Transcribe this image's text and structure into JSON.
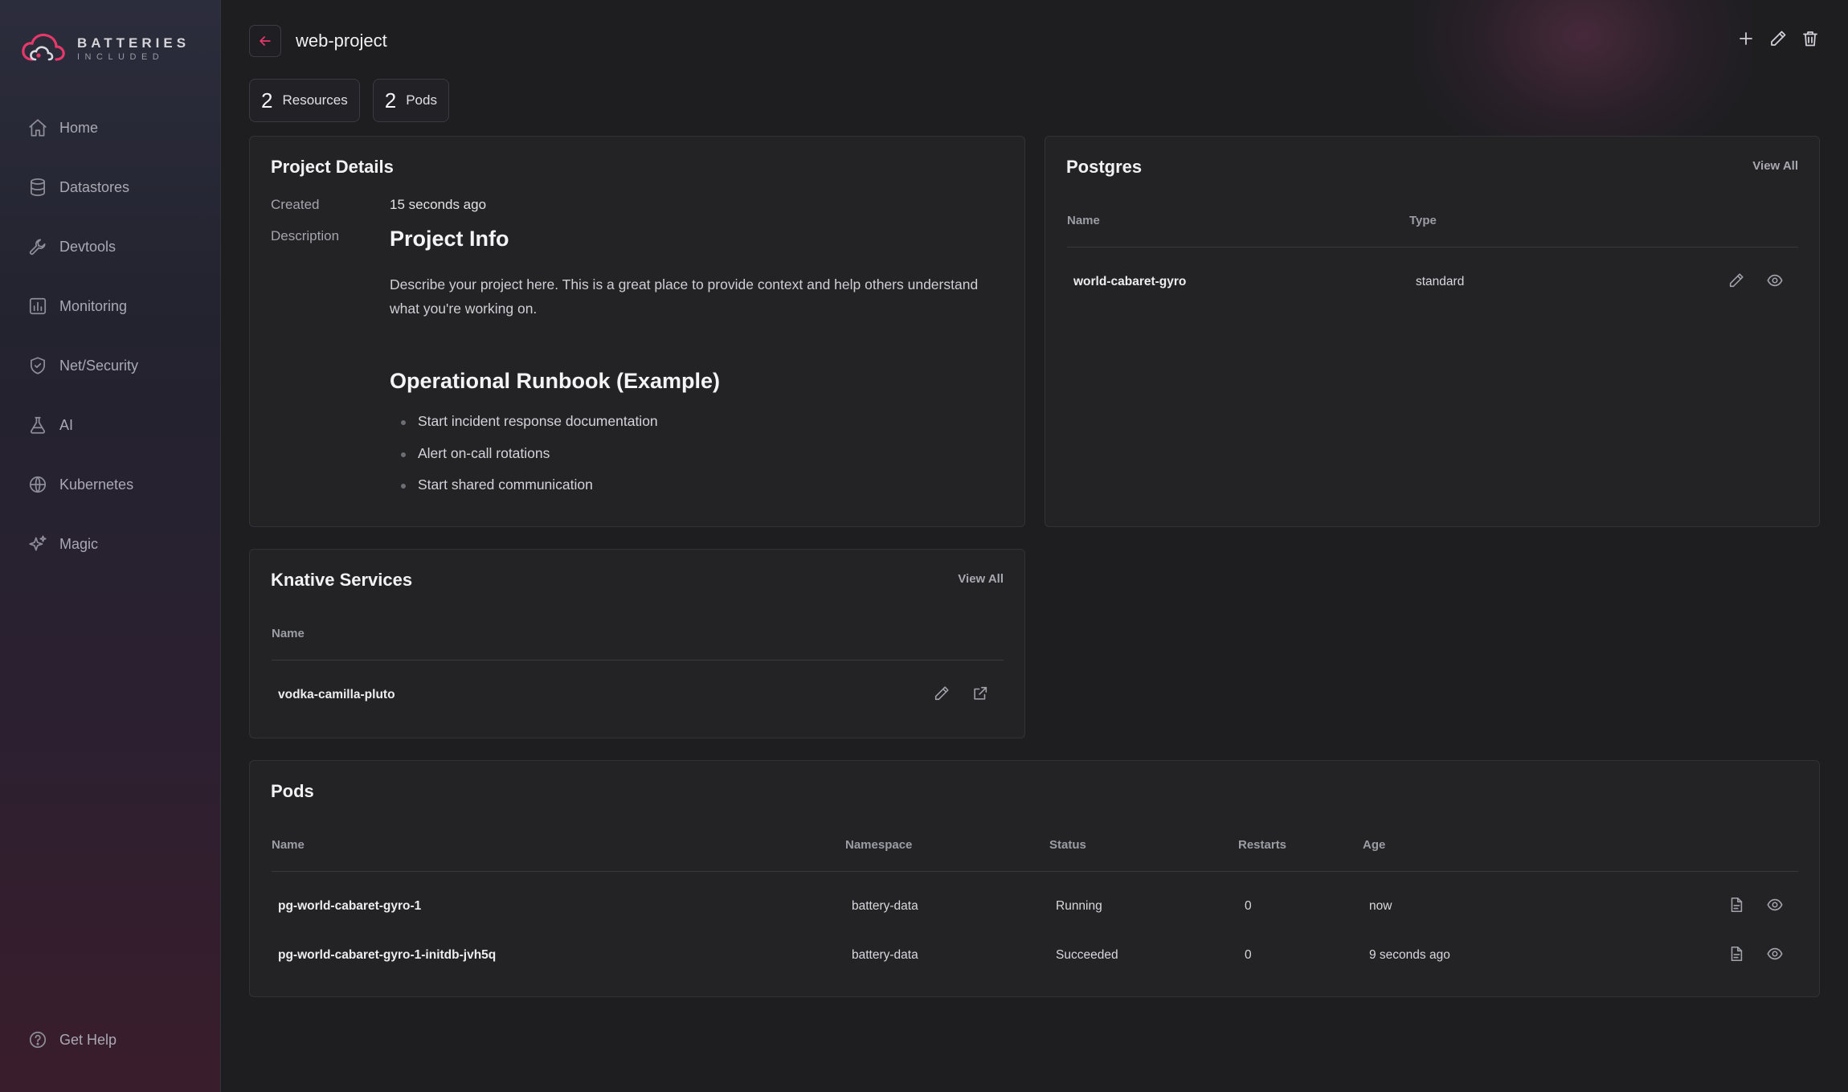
{
  "brand": {
    "title": "BATTERIES",
    "subtitle": "INCLUDED"
  },
  "sidebar": {
    "items": [
      {
        "label": "Home",
        "icon": "home-icon"
      },
      {
        "label": "Datastores",
        "icon": "database-icon"
      },
      {
        "label": "Devtools",
        "icon": "wrench-icon"
      },
      {
        "label": "Monitoring",
        "icon": "chart-icon"
      },
      {
        "label": "Net/Security",
        "icon": "shield-icon"
      },
      {
        "label": "AI",
        "icon": "flask-icon"
      },
      {
        "label": "Kubernetes",
        "icon": "globe-icon"
      },
      {
        "label": "Magic",
        "icon": "sparkles-icon"
      }
    ],
    "help": {
      "label": "Get Help",
      "icon": "question-icon"
    }
  },
  "header": {
    "title": "web-project"
  },
  "stats": [
    {
      "value": "2",
      "label": "Resources"
    },
    {
      "value": "2",
      "label": "Pods"
    }
  ],
  "details": {
    "title": "Project Details",
    "created_label": "Created",
    "created_value": "15 seconds ago",
    "description_label": "Description",
    "heading1": "Project Info",
    "paragraph": "Describe your project here. This is a great place to provide context and help others understand what you're working on.",
    "heading2": "Operational Runbook (Example)",
    "bullets": [
      "Start incident response documentation",
      "Alert on-call rotations",
      "Start shared communication"
    ]
  },
  "postgres": {
    "title": "Postgres",
    "view_all": "View All",
    "columns": {
      "name": "Name",
      "type": "Type"
    },
    "rows": [
      {
        "name": "world-cabaret-gyro",
        "type": "standard"
      }
    ]
  },
  "knative": {
    "title": "Knative Services",
    "view_all": "View All",
    "columns": {
      "name": "Name"
    },
    "rows": [
      {
        "name": "vodka-camilla-pluto"
      }
    ]
  },
  "pods": {
    "title": "Pods",
    "columns": {
      "name": "Name",
      "namespace": "Namespace",
      "status": "Status",
      "restarts": "Restarts",
      "age": "Age"
    },
    "rows": [
      {
        "name": "pg-world-cabaret-gyro-1",
        "namespace": "battery-data",
        "status": "Running",
        "restarts": "0",
        "age": "now"
      },
      {
        "name": "pg-world-cabaret-gyro-1-initdb-jvh5q",
        "namespace": "battery-data",
        "status": "Succeeded",
        "restarts": "0",
        "age": "9 seconds ago"
      }
    ]
  },
  "colors": {
    "accent": "#e5386b",
    "background": "#1e1e21",
    "card": "#232326"
  }
}
